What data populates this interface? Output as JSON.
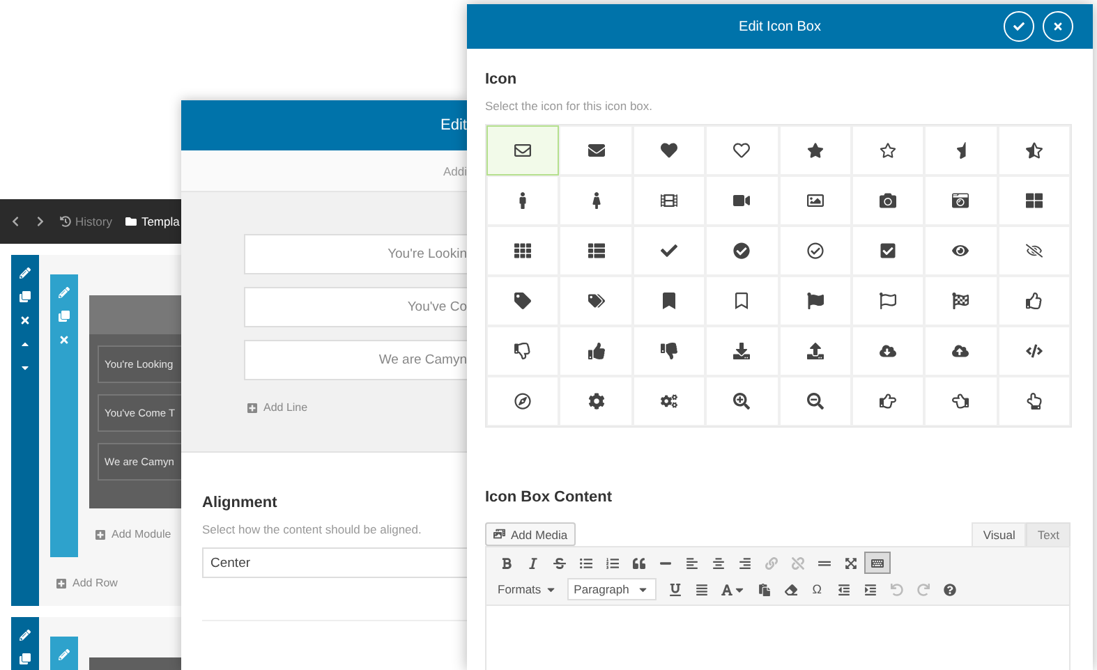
{
  "builder": {
    "toolbar": {
      "history": "History",
      "templates": "Templa"
    },
    "row": {
      "lines": [
        "You're Looking",
        "You've Come T",
        "We are Camyn"
      ],
      "add_module": "Add Module",
      "add_row": "Add Row"
    }
  },
  "settings_modal": {
    "title": "Edit",
    "subtitle": "Addi",
    "lines": [
      "You're Lookin",
      "You've Co",
      "We are Camyn"
    ],
    "add_line": "Add Line",
    "alignment": {
      "label": "Alignment",
      "hint": "Select how the content should be aligned.",
      "value": "Center"
    }
  },
  "icon_modal": {
    "title": "Edit Icon Box",
    "icon_section": {
      "label": "Icon",
      "hint": "Select the icon for this icon box."
    },
    "icon_grid": [
      {
        "selected": true
      },
      {
        "selected": false
      },
      {
        "selected": false
      },
      {
        "selected": false
      },
      {
        "selected": false
      },
      {
        "selected": false
      },
      {
        "selected": false
      },
      {
        "selected": false
      },
      {
        "selected": false
      },
      {
        "selected": false
      },
      {
        "selected": false
      },
      {
        "selected": false
      },
      {
        "selected": false
      },
      {
        "selected": false
      },
      {
        "selected": false
      },
      {
        "selected": false
      },
      {
        "selected": false
      },
      {
        "selected": false
      },
      {
        "selected": false
      },
      {
        "selected": false
      },
      {
        "selected": false
      },
      {
        "selected": false
      },
      {
        "selected": false
      },
      {
        "selected": false
      },
      {
        "selected": false
      },
      {
        "selected": false
      },
      {
        "selected": false
      },
      {
        "selected": false
      },
      {
        "selected": false
      },
      {
        "selected": false
      },
      {
        "selected": false
      },
      {
        "selected": false
      },
      {
        "selected": false
      },
      {
        "selected": false
      },
      {
        "selected": false
      },
      {
        "selected": false
      },
      {
        "selected": false
      },
      {
        "selected": false
      },
      {
        "selected": false
      },
      {
        "selected": false
      },
      {
        "selected": false
      },
      {
        "selected": false
      },
      {
        "selected": false
      },
      {
        "selected": false
      },
      {
        "selected": false
      },
      {
        "selected": false
      },
      {
        "selected": false
      },
      {
        "selected": false
      }
    ],
    "content_label": "Icon Box Content",
    "add_media": "Add Media",
    "tabs": [
      {
        "label": "Visual",
        "selected": true
      },
      {
        "label": "Text",
        "selected": false
      }
    ],
    "editor": {
      "formats": "Formats",
      "paragraph": "Paragraph",
      "symbol": "Ω",
      "toolbar_toggle_active": true
    }
  }
}
